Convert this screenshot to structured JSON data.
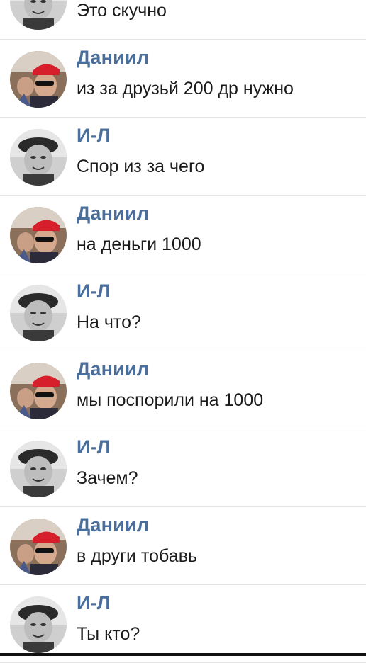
{
  "colors": {
    "name": "#4a6f9c",
    "message": "#1b1b1b",
    "divider": "#e3e4e8"
  },
  "messages": [
    {
      "author": "",
      "text": "Это скучно",
      "avatar": "il-avatar"
    },
    {
      "author": "Даниил",
      "text": "из за друзьй 200 др нужно",
      "avatar": "daniil-avatar"
    },
    {
      "author": "И-Л",
      "text": "Спор из за чего",
      "avatar": "il-avatar"
    },
    {
      "author": "Даниил",
      "text": "на деньги 1000",
      "avatar": "daniil-avatar"
    },
    {
      "author": "И-Л",
      "text": "На что?",
      "avatar": "il-avatar"
    },
    {
      "author": "Даниил",
      "text": "мы поспорили на 1000",
      "avatar": "daniil-avatar"
    },
    {
      "author": "И-Л",
      "text": "Зачем?",
      "avatar": "il-avatar"
    },
    {
      "author": "Даниил",
      "text": "в други тобавь",
      "avatar": "daniil-avatar"
    },
    {
      "author": "И-Л",
      "text": "Ты кто?",
      "avatar": "il-avatar"
    }
  ]
}
